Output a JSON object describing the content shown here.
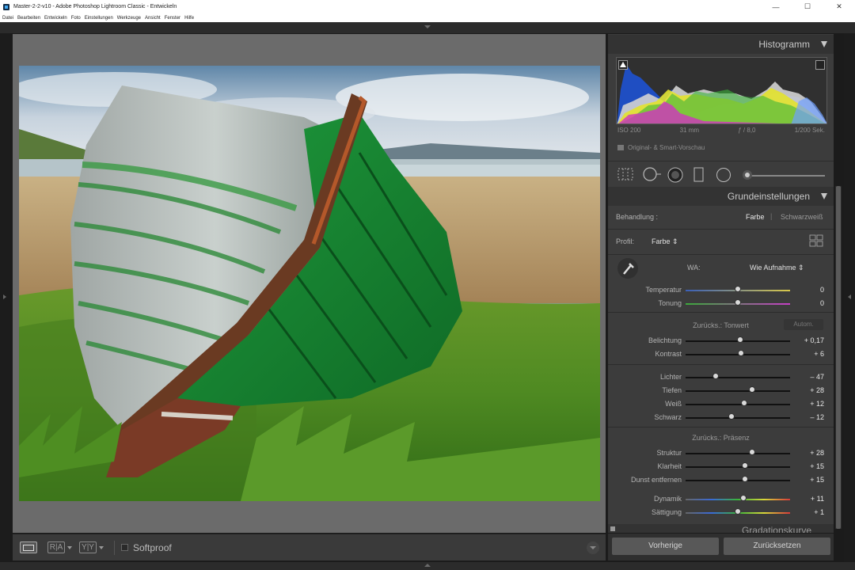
{
  "window": {
    "title": "Master-2-2-v10 - Adobe Photoshop Lightroom Classic - Entwickeln",
    "minimize": "—",
    "maximize": "☐",
    "close": "✕"
  },
  "menu": [
    "Datei",
    "Bearbeiten",
    "Entwickeln",
    "Foto",
    "Einstellungen",
    "Werkzeuge",
    "Ansicht",
    "Fenster",
    "Hilfe"
  ],
  "histogram": {
    "title": "Histogramm",
    "iso": "ISO 200",
    "focal": "31 mm",
    "aperture": "ƒ / 8,0",
    "shutter": "1/200 Sek.",
    "preview": "Original- & Smart-Vorschau"
  },
  "basic": {
    "title": "Grundeinstellungen",
    "treatment_label": "Behandlung :",
    "treatment_color": "Farbe",
    "treatment_bw": "Schwarzweiß",
    "profile_label": "Profil:",
    "profile_value": "Farbe ⇕",
    "wb_label": "WA:",
    "wb_value": "Wie Aufnahme ⇕",
    "tone_reset": "Zurücks.: Tonwert",
    "auto": "Autom.",
    "presence_reset": "Zurücks.: Präsenz",
    "sliders": [
      {
        "label": "Temperatur",
        "value": "0",
        "pos": 0.5
      },
      {
        "label": "Tonung",
        "value": "0",
        "pos": 0.5
      },
      {
        "label": "Belichtung",
        "value": "+ 0,17",
        "pos": 0.52
      },
      {
        "label": "Kontrast",
        "value": "+ 6",
        "pos": 0.53
      },
      {
        "label": "Lichter",
        "value": "– 47",
        "pos": 0.29
      },
      {
        "label": "Tiefen",
        "value": "+ 28",
        "pos": 0.64
      },
      {
        "label": "Weiß",
        "value": "+ 12",
        "pos": 0.56
      },
      {
        "label": "Schwarz",
        "value": "– 12",
        "pos": 0.44
      },
      {
        "label": "Struktur",
        "value": "+ 28",
        "pos": 0.64
      },
      {
        "label": "Klarheit",
        "value": "+ 15",
        "pos": 0.57
      },
      {
        "label": "Dunst entfernen",
        "value": "+ 15",
        "pos": 0.57
      },
      {
        "label": "Dynamik",
        "value": "+ 11",
        "pos": 0.55
      },
      {
        "label": "Sättigung",
        "value": "+ 1",
        "pos": 0.5
      }
    ],
    "next_section": "Gradationskurve"
  },
  "toolbar": {
    "before_after_label": "R|A",
    "before_after_label2": "Y|Y",
    "softproof": "Softproof"
  },
  "buttons": {
    "previous": "Vorherige",
    "reset": "Zurücksetzen"
  }
}
